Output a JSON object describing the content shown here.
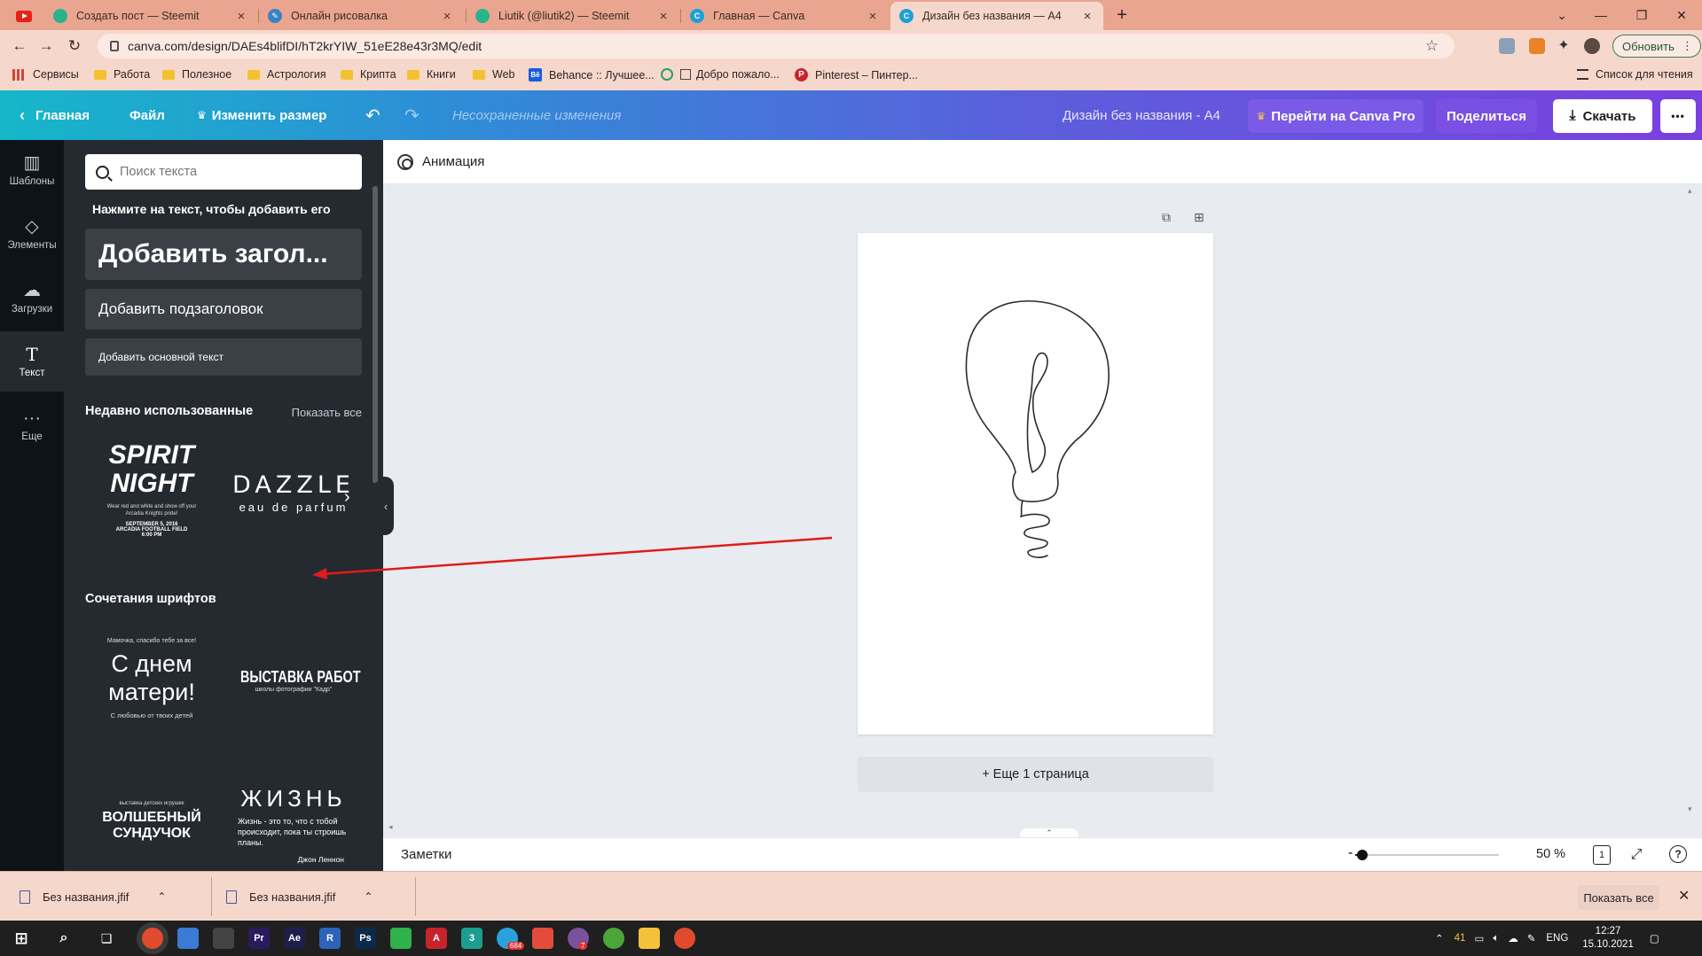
{
  "browser": {
    "tabs": [
      {
        "title": "Создать пост — Steemit",
        "icon": "steemit-icon",
        "color": "#2ab38a"
      },
      {
        "title": "Онлайн рисовалка",
        "icon": "pencil-icon",
        "color": "#3b82c4"
      },
      {
        "title": "Liutik (@liutik2) — Steemit",
        "icon": "steemit-icon",
        "color": "#2ab38a"
      },
      {
        "title": "Главная — Canva",
        "icon": "canva-icon",
        "color": "#1f9fd9"
      },
      {
        "title": "Дизайн без названия — A4",
        "icon": "canva-icon",
        "color": "#1f9fd9"
      }
    ],
    "new_tab": "+",
    "url": "canva.com/design/DAEs4blifDI/hT2krYIW_51eE28e43r3MQ/edit",
    "update_label": "Обновить",
    "bookmarks": [
      {
        "label": "Сервисы",
        "icon": "apps-grid-icon"
      },
      {
        "label": "Работа",
        "icon": "folder-icon"
      },
      {
        "label": "Полезное",
        "icon": "folder-icon"
      },
      {
        "label": "Астрология",
        "icon": "folder-icon"
      },
      {
        "label": "Крипта",
        "icon": "folder-icon"
      },
      {
        "label": "Книги",
        "icon": "folder-icon"
      },
      {
        "label": "Web",
        "icon": "folder-icon"
      },
      {
        "label": "Behance :: Лучшее...",
        "icon": "behance-icon"
      },
      {
        "label": "Добро пожало...",
        "icon": "site-icon"
      },
      {
        "label": "Pinterest – Пинтер...",
        "icon": "pinterest-icon"
      }
    ],
    "reading_list": "Список для чтения"
  },
  "canva": {
    "home": "Главная",
    "file": "Файл",
    "resize": "Изменить размер",
    "unsaved": "Несохраненные изменения",
    "design_title": "Дизайн без названия - A4",
    "go_pro": "Перейти на Canva Pro",
    "share": "Поделиться",
    "download": "Скачать",
    "more": "•••",
    "accent_pro": "#5b3fd6",
    "rail": [
      {
        "label": "Шаблоны",
        "icon": "templates-icon"
      },
      {
        "label": "Элементы",
        "icon": "elements-icon"
      },
      {
        "label": "Загрузки",
        "icon": "upload-cloud-icon"
      },
      {
        "label": "Текст",
        "icon": "text-icon"
      },
      {
        "label": "Еще",
        "icon": "more-dots-icon"
      }
    ],
    "panel": {
      "search_placeholder": "Поиск текста",
      "hint": "Нажмите на текст, чтобы добавить его",
      "add_heading": "Добавить загол...",
      "add_subheading": "Добавить подзаголовок",
      "add_body": "Добавить основной текст",
      "recent_title": "Недавно использованные",
      "show_all": "Показать все",
      "recent": [
        {
          "line1": "SPIRIT",
          "line2": "NIGHT",
          "small": "Wear red and white and show off your Arcadia Knights pride!",
          "date": "SEPTEMBER 5, 2016",
          "place": "ARCADIA FOOTBALL FIELD",
          "time": "6:00 PM"
        },
        {
          "line1": "DAZZLE",
          "line2": "eau de parfum"
        }
      ],
      "combos_title": "Сочетания шрифтов",
      "combos": [
        {
          "top": "Мамочка, спасибо тебе за все!",
          "main": "С днем матери!",
          "bottom": "С любовью от твоих детей"
        },
        {
          "main": "ВЫСТАВКА РАБОТ",
          "sub": "школы фотографии \"Кадр\""
        },
        {
          "top": "выставка детских игрушек",
          "main": "ВОЛШЕБНЫЙ СУНДУЧОК"
        },
        {
          "main": "ЖИЗНЬ",
          "body": "Жизнь - это то, что с тобой происходит, пока ты строишь планы.",
          "author": "Джон Леннон"
        }
      ]
    },
    "animation": "Анимация",
    "add_page": "+ Еще 1 страница",
    "notes": "Заметки",
    "zoom": "50 %",
    "zoom_level": 0.05,
    "page_count": "1"
  },
  "downloads": [
    {
      "name": "Без названия.jfif"
    },
    {
      "name": "Без названия.jfif"
    }
  ],
  "downloads_show_all": "Показать все",
  "taskbar": {
    "apps": [
      {
        "icon": "chrome-icon",
        "label": "",
        "color": "#e24a2d"
      },
      {
        "icon": "store-icon",
        "label": "",
        "color": "#3a7bd5"
      },
      {
        "icon": "mail-icon",
        "label": "",
        "color": "#444"
      },
      {
        "icon": "premiere-icon",
        "label": "Pr",
        "color": "#2a1a5e"
      },
      {
        "icon": "after-effects-icon",
        "label": "Ae",
        "color": "#1f1d4a"
      },
      {
        "icon": "r-app-icon",
        "label": "R",
        "color": "#2c64b8"
      },
      {
        "icon": "photoshop-icon",
        "label": "Ps",
        "color": "#0b2a4a"
      },
      {
        "icon": "phone-app-icon",
        "label": "",
        "color": "#2fb14b"
      },
      {
        "icon": "acrobat-icon",
        "label": "A",
        "color": "#c8232c"
      },
      {
        "icon": "3-app-icon",
        "label": "3",
        "color": "#1b9e8f"
      },
      {
        "icon": "telegram-icon",
        "label": "",
        "color": "#2aa1da"
      },
      {
        "icon": "anydesk-icon",
        "label": "",
        "color": "#e34c3b"
      },
      {
        "icon": "viber-icon",
        "label": "",
        "color": "#7b519d"
      },
      {
        "icon": "utorrent-icon",
        "label": "",
        "color": "#4ca539"
      },
      {
        "icon": "explorer-icon",
        "label": "",
        "color": "#f3c13a"
      },
      {
        "icon": "chrome-2-icon",
        "label": "",
        "color": "#e24a2d"
      }
    ],
    "badges": {
      "telegram": "684",
      "viber": "7"
    },
    "tray_temp": "41",
    "lang": "ENG",
    "time": "12:27",
    "date": "15.10.2021"
  }
}
